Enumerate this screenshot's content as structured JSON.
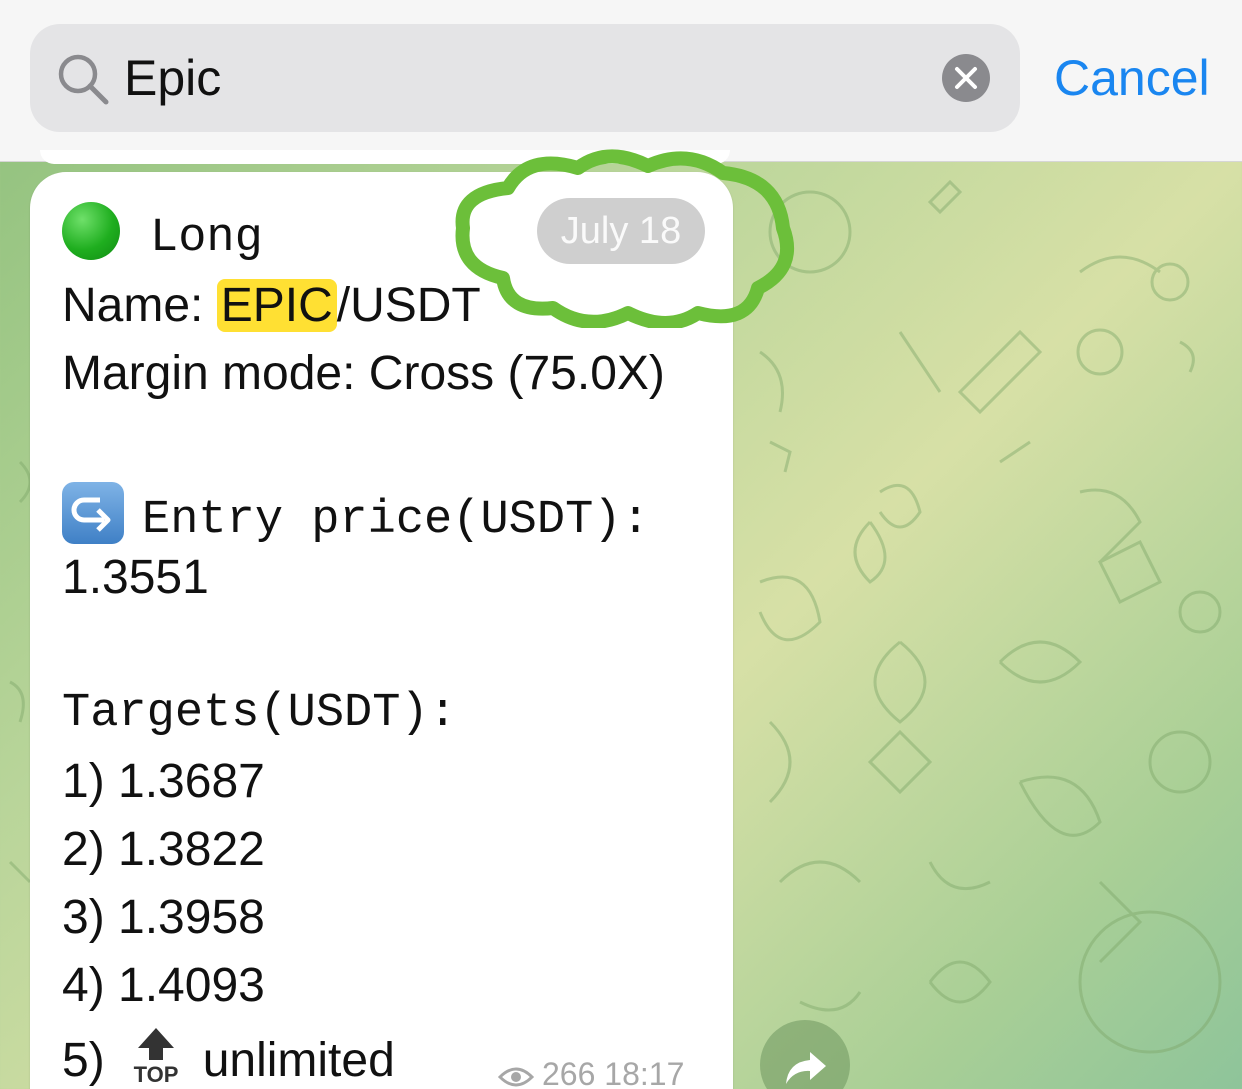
{
  "search": {
    "query": "Epic",
    "cancel_label": "Cancel"
  },
  "message": {
    "direction_label": "Long",
    "name_prefix": "Name: ",
    "name_highlight": "EPIC",
    "name_suffix": "/USDT",
    "margin_line": "Margin mode: Cross (75.0X)",
    "entry_label": "Entry price(USDT):",
    "entry_value": "1.3551",
    "targets_label": "Targets(USDT):",
    "targets": [
      "1) 1.3687",
      "2) 1.3822",
      "3) 1.3958",
      "4) 1.4093"
    ],
    "target_5_prefix": "5)",
    "target_5_label": "unlimited",
    "views": "266",
    "time": "18:17"
  },
  "date_badge": "July 18",
  "colors": {
    "accent": "#1a86f0",
    "highlight": "#ffe033",
    "doodle": "#6cbf3a"
  },
  "icons": [
    "search-icon",
    "clear-icon",
    "green-circle-icon",
    "entry-arrow-icon",
    "top-arrow-icon",
    "eye-icon",
    "forward-icon"
  ]
}
